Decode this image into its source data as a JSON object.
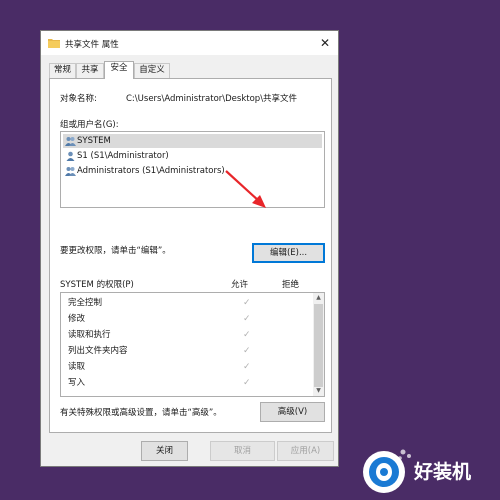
{
  "window": {
    "title": "共享文件 属性",
    "close_label": "✕"
  },
  "tabs": [
    {
      "label": "常规",
      "active": false
    },
    {
      "label": "共享",
      "active": false
    },
    {
      "label": "安全",
      "active": true
    },
    {
      "label": "自定义",
      "active": false
    }
  ],
  "object": {
    "label": "对象名称:",
    "value": "C:\\Users\\Administrator\\Desktop\\共享文件"
  },
  "groups": {
    "label": "组或用户名(G):",
    "users": [
      {
        "name": "SYSTEM",
        "icon": "users-group-icon",
        "selected": true
      },
      {
        "name": "S1 (S1\\Administrator)",
        "icon": "user-icon",
        "selected": false
      },
      {
        "name": "Administrators (S1\\Administrators)",
        "icon": "users-group-icon",
        "selected": false
      }
    ]
  },
  "edit": {
    "hint": "要更改权限，请单击“编辑”。",
    "button_label": "编辑(E)..."
  },
  "permissions": {
    "label": "SYSTEM 的权限(P)",
    "allow_header": "允许",
    "deny_header": "拒绝",
    "rows": [
      {
        "name": "完全控制",
        "allow": true
      },
      {
        "name": "修改",
        "allow": true
      },
      {
        "name": "读取和执行",
        "allow": true
      },
      {
        "name": "列出文件夹内容",
        "allow": true
      },
      {
        "name": "读取",
        "allow": true
      },
      {
        "name": "写入",
        "allow": true
      }
    ]
  },
  "advanced": {
    "hint": "有关特殊权限或高级设置，请单击“高级”。",
    "button_label": "高级(V)"
  },
  "footer": {
    "ok_label": "关闭",
    "cancel_label": "取消",
    "apply_label": "应用(A)"
  },
  "colors": {
    "background": "#4a2c66",
    "annotation_arrow": "#e8262a",
    "focus_border": "#0078d7"
  },
  "watermark": {
    "text": "好装机"
  }
}
